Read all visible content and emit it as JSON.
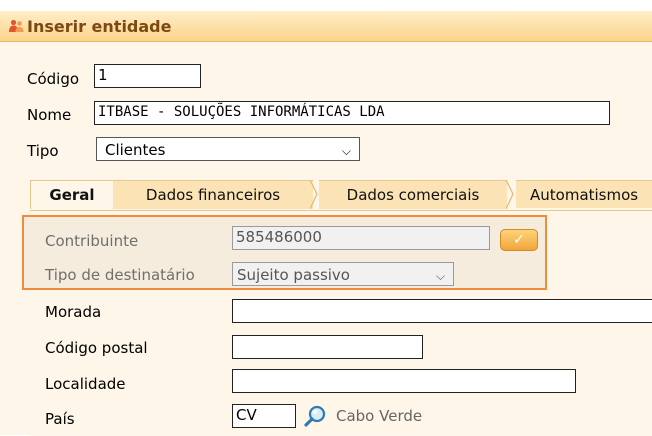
{
  "window": {
    "title": "Inserir entidade",
    "icon": "people-icon"
  },
  "header_fields": {
    "codigo": {
      "label": "Código",
      "value": "1"
    },
    "nome": {
      "label": "Nome",
      "value": "ITBASE - SOLUÇÕES INFORMÁTICAS LDA"
    },
    "tipo": {
      "label": "Tipo",
      "value": "Clientes"
    }
  },
  "tabs": [
    {
      "label": "Geral",
      "active": true
    },
    {
      "label": "Dados financeiros",
      "active": false
    },
    {
      "label": "Dados comerciais",
      "active": false
    },
    {
      "label": "Automatismos",
      "active": false
    }
  ],
  "geral": {
    "contribuinte": {
      "label": "Contribuinte",
      "value": "585486000",
      "button": "✓"
    },
    "tipo_destinatario": {
      "label": "Tipo de destinatário",
      "value": "Sujeito passivo"
    },
    "morada": {
      "label": "Morada",
      "value": ""
    },
    "codigo_postal": {
      "label": "Código postal",
      "value": ""
    },
    "localidade": {
      "label": "Localidade",
      "value": ""
    },
    "pais": {
      "label": "País",
      "code": "CV",
      "name": "Cabo Verde"
    }
  },
  "colors": {
    "highlight_border": "#f08a3c",
    "title_text": "#7a4a12",
    "tab_bg": "#fbe3b6"
  }
}
